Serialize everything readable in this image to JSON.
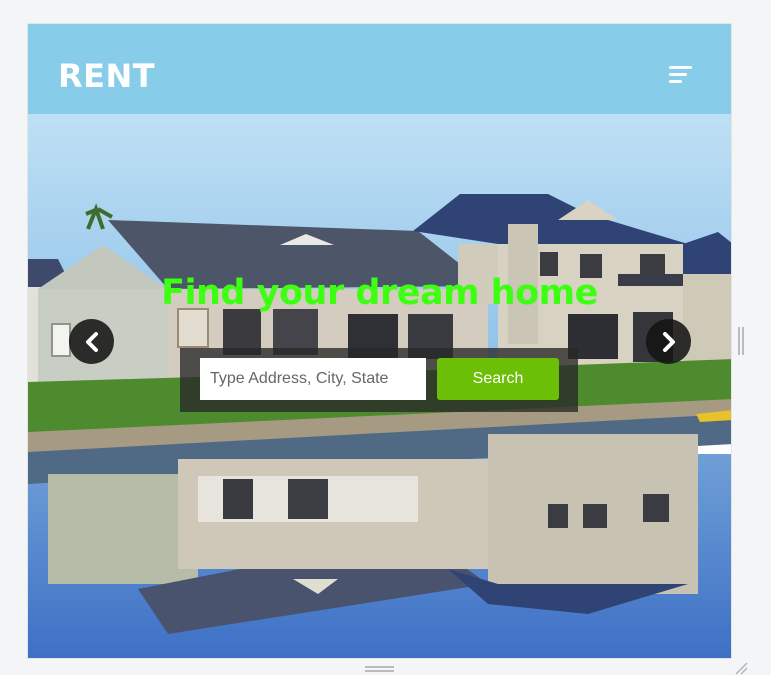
{
  "navbar": {
    "brand": "RENT",
    "menu_icon": "menu-bars-icon",
    "background_color": "#87cdea"
  },
  "hero": {
    "headline": "Find your dream home",
    "headline_color": "#3cff12",
    "search": {
      "placeholder": "Type Address, City, State",
      "value": "",
      "button_label": "Search",
      "button_color": "#6bbf06"
    },
    "carousel": {
      "prev_icon": "chevron-left-icon",
      "next_icon": "chevron-right-icon"
    }
  }
}
